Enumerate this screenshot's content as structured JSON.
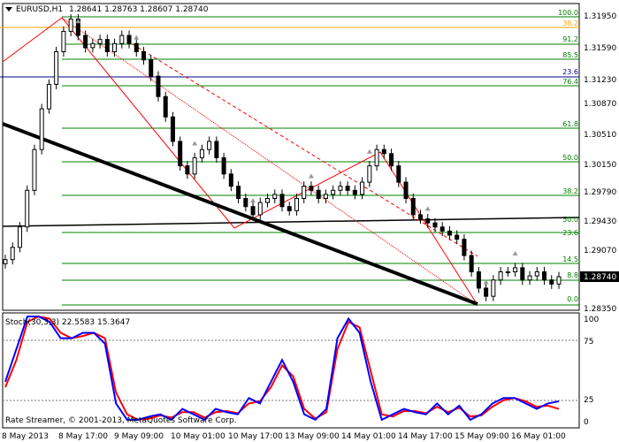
{
  "header": {
    "symbol": "EURUSD,H1",
    "ohlc": "1.28641 1.28763 1.28607 1.28740"
  },
  "price_axis": {
    "labels": [
      "1.31950",
      "1.31590",
      "1.31230",
      "1.30870",
      "1.30510",
      "1.30150",
      "1.29790",
      "1.29430",
      "1.29070",
      "1.28350"
    ],
    "current_price": "1.28740"
  },
  "fibo_levels": [
    "100.0",
    "38.2",
    "91.2",
    "85.5",
    "23.6",
    "76.4",
    "61.8",
    "50.0",
    "38.2",
    "50.0",
    "23.6",
    "14.5",
    "8.8",
    "0.0"
  ],
  "indicator": {
    "title": "Stoch(30,3,3) 22.5583 15.3647",
    "levels": [
      "100",
      "75",
      "25",
      "0"
    ]
  },
  "watermark": "Rate Streamer, © 2001-2013, MetaQuotes Software Corp.",
  "time_axis": [
    "8 May 2013",
    "8 May 17:00",
    "9 May 09:00",
    "10 May 01:00",
    "10 May 17:00",
    "13 May 09:00",
    "14 May 01:00",
    "14 May 17:00",
    "15 May 09:00",
    "16 May 01:00"
  ],
  "colors": {
    "background": "#ffffff",
    "bull": "#000000",
    "fibo": "#008000",
    "fibo_golden": "#ffa500",
    "channel": "#ff0000",
    "trendline": "#000000",
    "hline_blue": "#00008b",
    "stoch_main": "#0000ff",
    "stoch_signal": "#ff0000"
  },
  "chart_data": {
    "type": "candlestick",
    "symbol": "EURUSD",
    "timeframe": "H1",
    "closes": [
      1.2895,
      1.291,
      1.2935,
      1.298,
      1.303,
      1.308,
      1.311,
      1.315,
      1.3175,
      1.319,
      1.317,
      1.3155,
      1.316,
      1.3165,
      1.315,
      1.316,
      1.317,
      1.316,
      1.315,
      1.314,
      1.312,
      1.3095,
      1.307,
      1.304,
      1.301,
      1.3,
      1.302,
      1.303,
      1.304,
      1.302,
      1.3,
      1.2985,
      1.297,
      1.296,
      1.295,
      1.2965,
      1.297,
      1.2975,
      1.296,
      1.2955,
      1.297,
      1.2985,
      1.298,
      1.297,
      1.2975,
      1.298,
      1.2985,
      1.298,
      1.2975,
      1.299,
      1.301,
      1.303,
      1.3025,
      1.301,
      1.299,
      1.297,
      1.295,
      1.2945,
      1.294,
      1.2935,
      1.293,
      1.2925,
      1.292,
      1.29,
      1.288,
      1.286,
      1.285,
      1.287,
      1.288,
      1.288,
      1.2885,
      1.287,
      1.2875,
      1.288,
      1.287,
      1.2865,
      1.2874
    ],
    "stochastic": {
      "name": "Stoch(30,3,3)",
      "main_last": 22.5583,
      "signal_last": 15.3647,
      "main": [
        40,
        70,
        100,
        100,
        95,
        80,
        80,
        85,
        85,
        75,
        20,
        5,
        5,
        8,
        10,
        5,
        15,
        10,
        5,
        15,
        12,
        10,
        25,
        20,
        40,
        60,
        40,
        10,
        5,
        15,
        80,
        98,
        85,
        40,
        5,
        10,
        15,
        12,
        10,
        20,
        10,
        18,
        5,
        10,
        20,
        25,
        25,
        20,
        15,
        20,
        22
      ],
      "signal": [
        35,
        60,
        95,
        100,
        98,
        85,
        80,
        82,
        85,
        80,
        30,
        10,
        5,
        6,
        9,
        7,
        12,
        12,
        7,
        12,
        13,
        11,
        20,
        22,
        35,
        55,
        45,
        15,
        6,
        12,
        70,
        95,
        90,
        50,
        10,
        8,
        13,
        13,
        11,
        17,
        12,
        16,
        8,
        9,
        17,
        23,
        25,
        22,
        17,
        18,
        15
      ]
    }
  }
}
